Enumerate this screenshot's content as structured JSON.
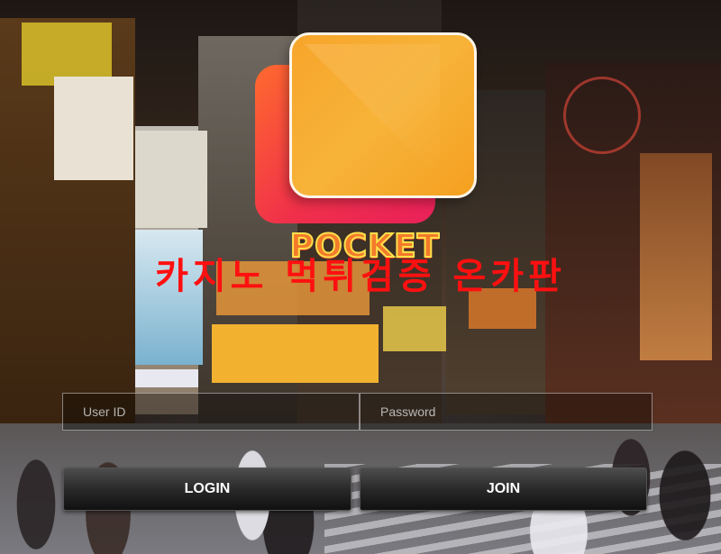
{
  "brand": {
    "wordmark": "POCKET",
    "headline": "카지노 먹튀검증 온카판"
  },
  "login_form": {
    "user_id_placeholder": "User ID",
    "password_placeholder": "Password",
    "login_label": "LOGIN",
    "join_label": "JOIN"
  },
  "colors": {
    "headline": "#ff1010",
    "logo_front": "#f7a52a",
    "logo_back": "#f0304a",
    "button": "#262626"
  }
}
